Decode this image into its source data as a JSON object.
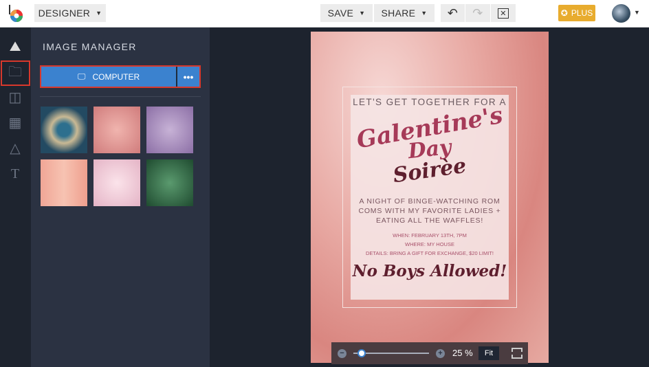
{
  "topbar": {
    "mode_label": "DESIGNER",
    "save_label": "SAVE",
    "share_label": "SHARE",
    "plus_label": "PLUS"
  },
  "sidebar": {
    "icons": [
      "image-icon",
      "folder-icon",
      "layout-icon",
      "grid-icon",
      "shape-icon",
      "text-icon"
    ]
  },
  "panel": {
    "title": "IMAGE MANAGER",
    "computer_label": "COMPUTER",
    "more_label": "•••",
    "thumbnails": [
      "heart-waffle",
      "pink-watercolor",
      "purple-watercolor",
      "peach-watercolor",
      "pink-bokeh",
      "green-leaves"
    ]
  },
  "poster": {
    "line1": "LET'S GET TOGETHER FOR A",
    "script1": "Galentine's",
    "script2": "Day",
    "script3": "Soirèe",
    "body": "A NIGHT OF BINGE-WATCHING ROM COMS WITH MY FAVORITE LADIES + EATING ALL THE WAFFLES!",
    "when": "WHEN: FEBRUARY 13TH, 7PM",
    "where": "WHERE: MY HOUSE",
    "details": "DETAILS: BRING A GIFT FOR EXCHANGE, $20 LIMIT!",
    "footer": "No Boys Allowed!"
  },
  "zoom": {
    "percent_label": "25 %",
    "percent": 25,
    "fit_label": "Fit",
    "minus": "−",
    "plus": "+"
  }
}
